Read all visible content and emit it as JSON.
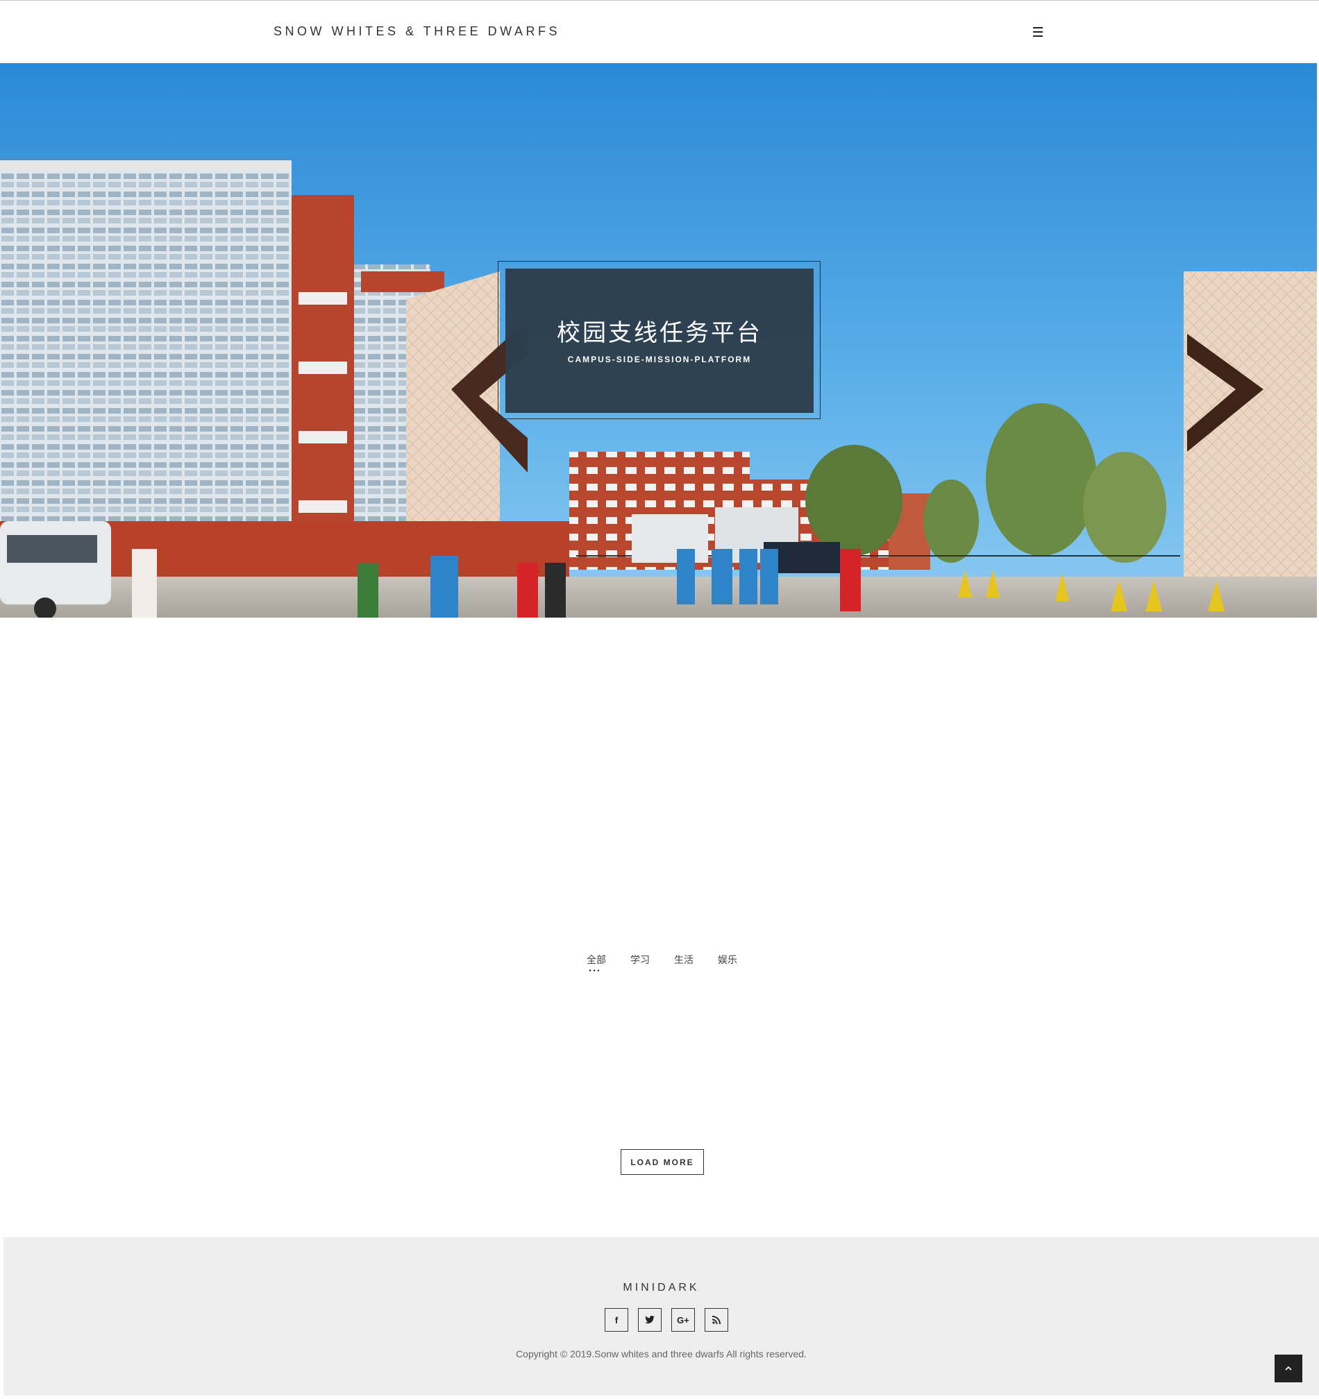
{
  "header": {
    "brand": "SNOW WHITES & THREE DWARFS",
    "menu_icon": "hamburger-icon"
  },
  "hero": {
    "title": "校园支线任务平台",
    "subtitle": "CAMPUS-SIDE-MISSION-PLATFORM"
  },
  "filters": {
    "items": [
      "全部",
      "学习",
      "生活",
      "娱乐"
    ],
    "active": "全部"
  },
  "load_more": {
    "label": "LOAD MORE"
  },
  "footer": {
    "brand": "MINIDARK",
    "social_icons": [
      "facebook-icon",
      "twitter-icon",
      "google-plus-icon",
      "rss-icon"
    ],
    "social_labels": [
      "f",
      "",
      "G+",
      ""
    ],
    "copyright": "Copyright © 2019.Sonw whites and three dwarfs All rights reserved."
  },
  "back_to_top": {
    "icon": "chevron-up-icon"
  },
  "colors": {
    "hero_panel": "#2c3e4c",
    "sky_top": "#2e8fd8",
    "footer_bg": "#eeeeee",
    "dark": "#222222"
  }
}
